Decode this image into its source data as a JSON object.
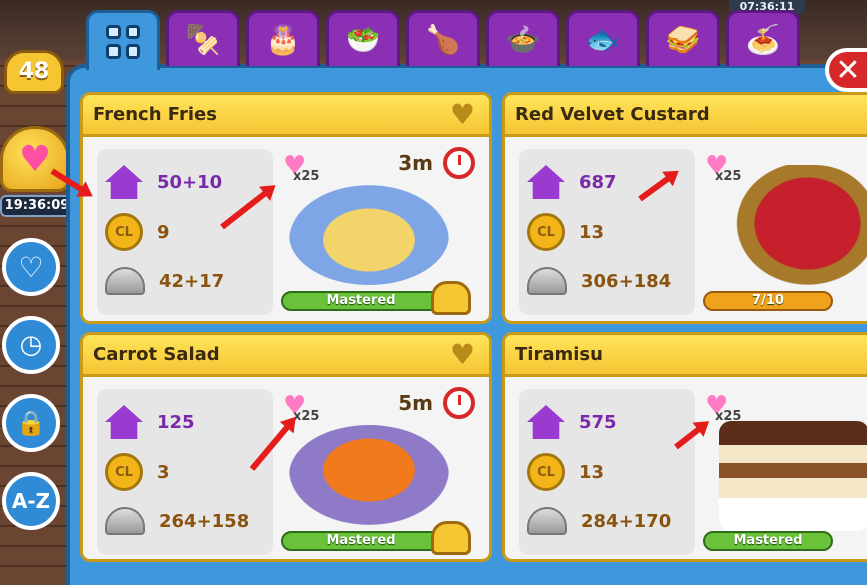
{
  "top_clock": "07:36:11",
  "player_level": "48",
  "bell_timer": "19:36:09",
  "tabs": [
    {
      "name": "all",
      "icon": "grid-icon"
    },
    {
      "name": "appetizers",
      "icon": "appetizer-icon",
      "glyph": "🍢"
    },
    {
      "name": "desserts",
      "icon": "cake-icon",
      "glyph": "🎂"
    },
    {
      "name": "salads",
      "icon": "salad-icon",
      "glyph": "🥗"
    },
    {
      "name": "meat",
      "icon": "drumstick-icon",
      "glyph": "🍗"
    },
    {
      "name": "soups",
      "icon": "soup-icon",
      "glyph": "🍲"
    },
    {
      "name": "fish",
      "icon": "fish-icon",
      "glyph": "🐟"
    },
    {
      "name": "sandwiches",
      "icon": "sandwich-icon",
      "glyph": "🥪"
    },
    {
      "name": "pasta",
      "icon": "pasta-icon",
      "glyph": "🍝"
    }
  ],
  "sidebar": {
    "az_label": "A-Z"
  },
  "recipes": [
    {
      "title": "French Fries",
      "xp": "50+10",
      "coins": "9",
      "servings": "42+17",
      "hearts_multiplier": "x25",
      "cook_time": "3m",
      "progress_label": "Mastered",
      "progress": 1.0
    },
    {
      "title": "Red Velvet Custard",
      "xp": "687",
      "coins": "13",
      "servings": "306+184",
      "hearts_multiplier": "x25",
      "cook_time": "",
      "progress_label": "7/10",
      "progress": 0.7
    },
    {
      "title": "Carrot Salad",
      "xp": "125",
      "coins": "3",
      "servings": "264+158",
      "hearts_multiplier": "x25",
      "cook_time": "5m",
      "progress_label": "Mastered",
      "progress": 1.0
    },
    {
      "title": "Tiramisu",
      "xp": "575",
      "coins": "13",
      "servings": "284+170",
      "hearts_multiplier": "x25",
      "cook_time": "",
      "progress_label": "Mastered",
      "progress": 1.0
    }
  ],
  "coin_label": "CL"
}
